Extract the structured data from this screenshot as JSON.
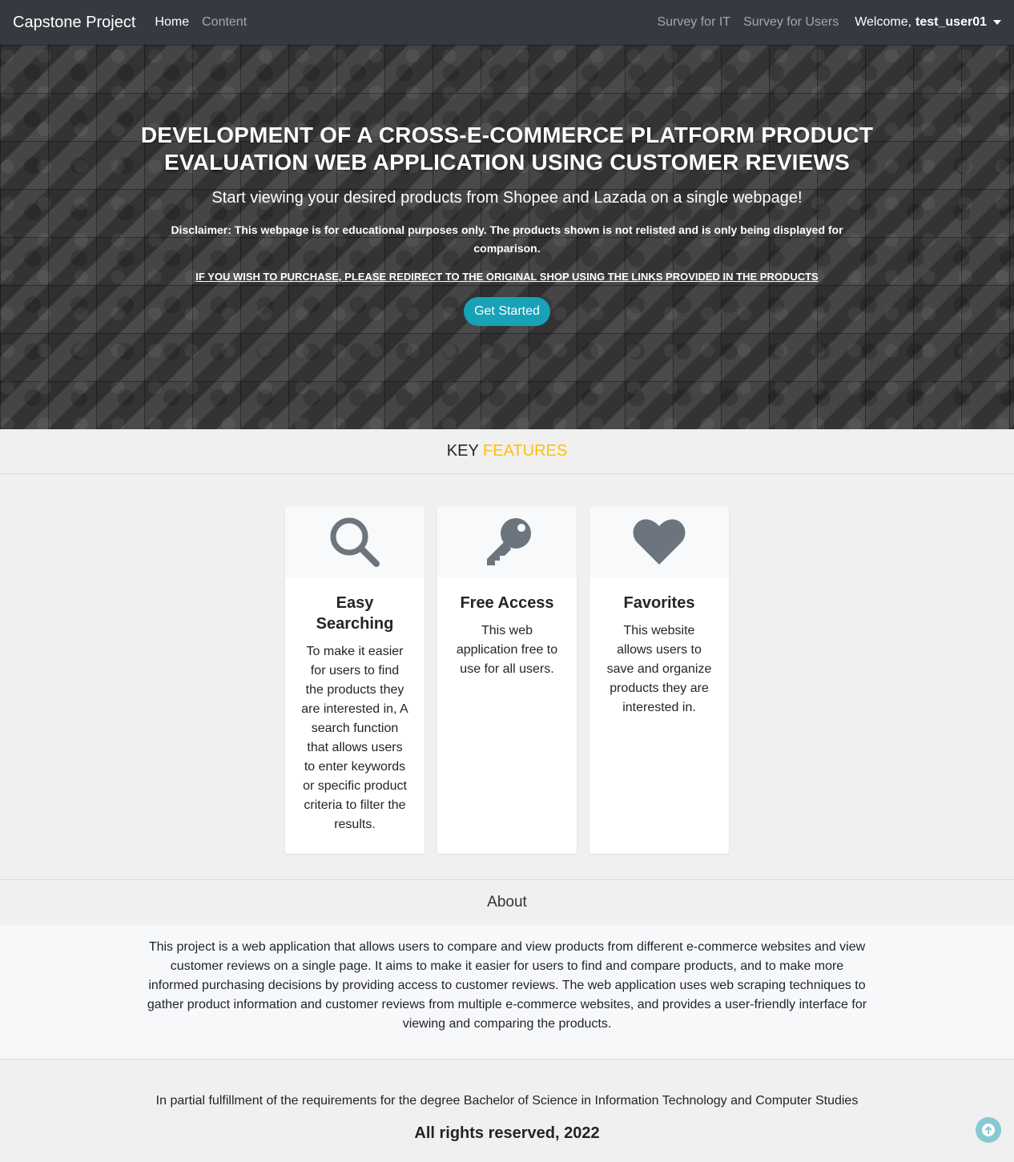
{
  "navbar": {
    "brand": "Capstone Project",
    "left_links": [
      {
        "label": "Home",
        "active": true
      },
      {
        "label": "Content",
        "active": false
      }
    ],
    "right_links": [
      {
        "label": "Survey for IT"
      },
      {
        "label": "Survey for Users"
      }
    ],
    "welcome_prefix": "Welcome,",
    "username": "test_user01",
    "dropdown_icon": "caret-down-icon"
  },
  "hero": {
    "title_line1": "DEVELOPMENT OF A CROSS-E-COMMERCE PLATFORM PRODUCT",
    "title_line2": "EVALUATION WEB APPLICATION USING CUSTOMER REVIEWS",
    "subtitle": "Start viewing your desired products from Shopee and Lazada on a single webpage!",
    "disclaimer": "Disclaimer: This webpage is for educational purposes only. The products shown is not relisted and is only being displayed for comparison.",
    "warning": "IF YOU WISH TO PURCHASE, PLEASE REDIRECT TO THE ORIGINAL SHOP USING THE LINKS PROVIDED IN THE PRODUCTS",
    "cta_label": "Get Started",
    "cta_color": "#17a2b8"
  },
  "key_features": {
    "heading_key": "KEY",
    "heading_features": "FEATURES",
    "accent_color": "#ffc107",
    "cards": [
      {
        "icon": "search-icon",
        "title": "Easy Searching",
        "text": "To make it easier for users to find the products they are interested in, A search function that allows users to enter keywords or specific product criteria to filter the results."
      },
      {
        "icon": "key-icon",
        "title": "Free Access",
        "text": "This web application free to use for all users."
      },
      {
        "icon": "heart-icon",
        "title": "Favorites",
        "text": "This website allows users to save and organize products they are interested in."
      }
    ]
  },
  "about": {
    "heading": "About",
    "text": "This project is a web application that allows users to compare and view products from different e-commerce websites and view customer reviews on a single page. It aims to make it easier for users to find and compare products, and to make more informed purchasing decisions by providing access to customer reviews. The web application uses web scraping techniques to gather product information and customer reviews from multiple e-commerce websites, and provides a user-friendly interface for viewing and comparing the products."
  },
  "footer": {
    "fulfillment": "In partial fulfillment of the requirements for the degree Bachelor of Science in Information Technology and Computer Studies",
    "copyright": "All rights reserved, 2022",
    "scroll_top_icon": "arrow-up-icon"
  }
}
